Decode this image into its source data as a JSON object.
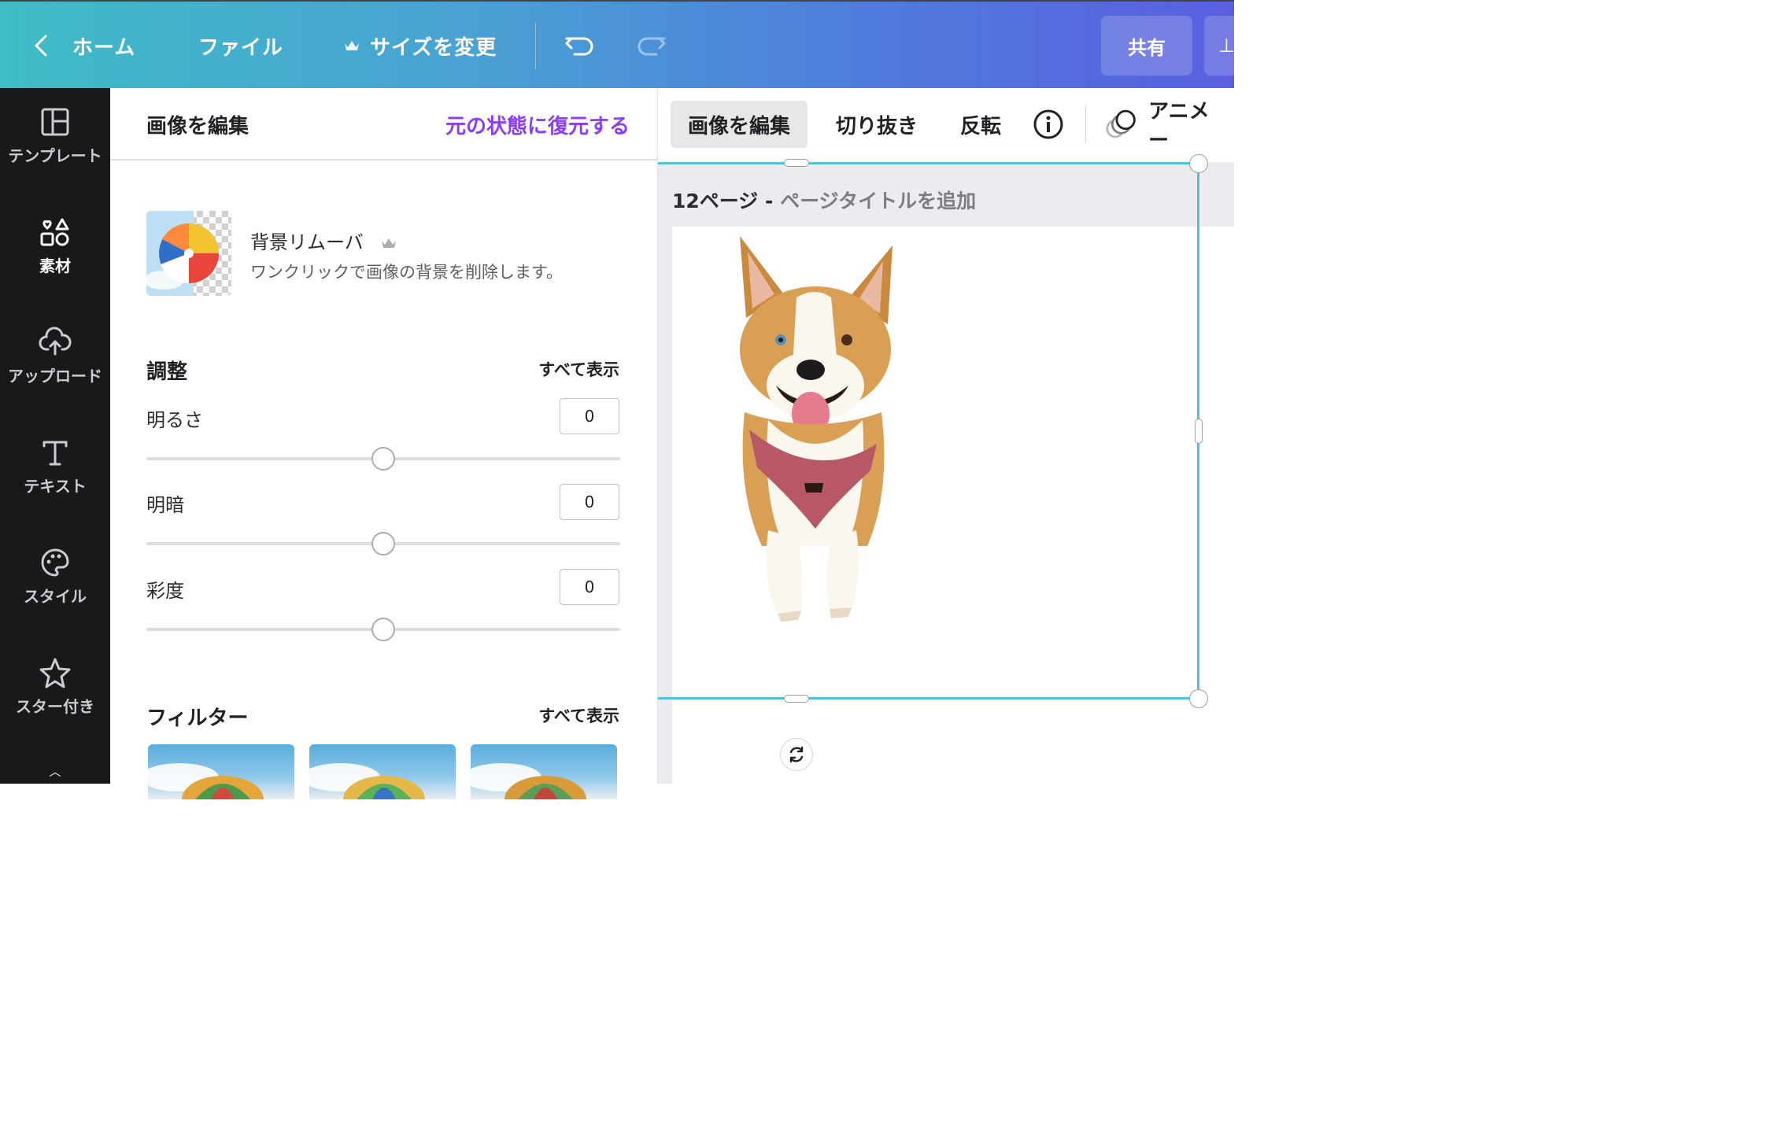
{
  "topbar": {
    "home_label": "ホーム",
    "file_label": "ファイル",
    "resize_label": "サイズを変更",
    "share_label": "共有",
    "download_label": "⊥"
  },
  "sidebar": {
    "items": [
      {
        "label": "テンプレート",
        "icon": "template-icon"
      },
      {
        "label": "素材",
        "icon": "elements-icon"
      },
      {
        "label": "アップロード",
        "icon": "upload-icon"
      },
      {
        "label": "テキスト",
        "icon": "text-icon"
      },
      {
        "label": "スタイル",
        "icon": "palette-icon"
      },
      {
        "label": "スター付き",
        "icon": "star-icon"
      }
    ]
  },
  "panel": {
    "title": "画像を編集",
    "restore_label": "元の状態に復元する",
    "bg_remover": {
      "title": "背景リムーバ",
      "description": "ワンクリックで画像の背景を削除します。"
    },
    "adjust": {
      "title": "調整",
      "see_all": "すべて表示",
      "items": [
        {
          "label": "明るさ",
          "value": "0"
        },
        {
          "label": "明暗",
          "value": "0"
        },
        {
          "label": "彩度",
          "value": "0"
        }
      ]
    },
    "filters": {
      "title": "フィルター",
      "see_all": "すべて表示"
    }
  },
  "context_toolbar": {
    "edit_image": "画像を編集",
    "crop": "切り抜き",
    "flip": "反転",
    "animate": "アニメー"
  },
  "canvas": {
    "page_number": "12ページ -",
    "page_title_placeholder": "ページタイトルを追加"
  },
  "colors": {
    "accent_purple": "#8b3dff",
    "selection": "#4fc3d6",
    "sidebar_bg": "#18191b"
  }
}
